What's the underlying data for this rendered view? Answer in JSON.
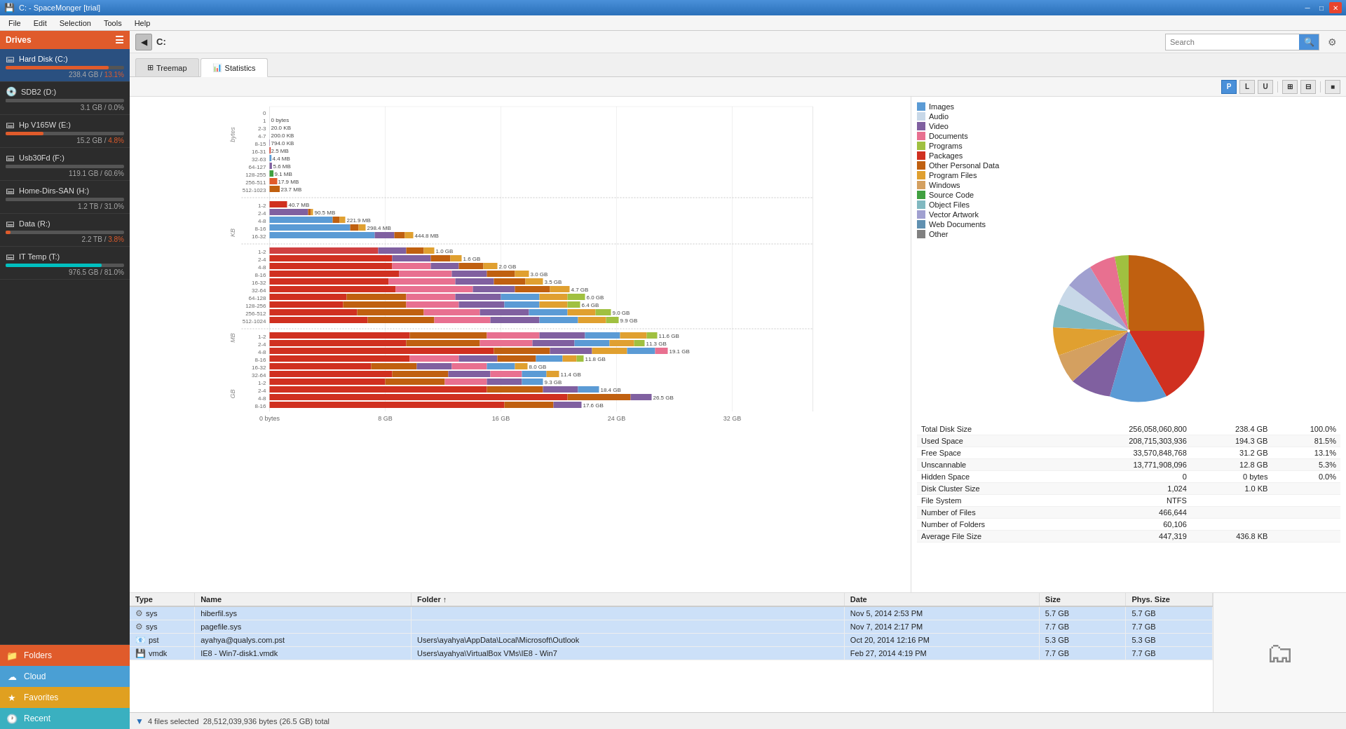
{
  "titlebar": {
    "title": "C: - SpaceMonger  [trial]",
    "controls": [
      "minimize",
      "maximize",
      "close"
    ]
  },
  "menubar": {
    "items": [
      "File",
      "Edit",
      "Selection",
      "Tools",
      "Help"
    ]
  },
  "toolbar": {
    "path": "C:",
    "search_placeholder": "Search",
    "gear_label": "⚙"
  },
  "tabs": [
    {
      "id": "treemap",
      "label": "Treemap",
      "active": false
    },
    {
      "id": "statistics",
      "label": "Statistics",
      "active": true
    }
  ],
  "view_buttons": [
    {
      "id": "btn-P",
      "label": "P",
      "active": true
    },
    {
      "id": "btn-L",
      "label": "L",
      "active": false
    },
    {
      "id": "btn-U",
      "label": "U",
      "active": false
    },
    {
      "id": "btn-grid1",
      "label": "⊞",
      "active": false
    },
    {
      "id": "btn-grid2",
      "label": "⊟",
      "active": false
    },
    {
      "id": "btn-grid3",
      "label": "☰",
      "active": false
    },
    {
      "id": "btn-dark",
      "label": "■",
      "active": false
    }
  ],
  "sidebar": {
    "drives_label": "Drives",
    "drives": [
      {
        "name": "Hard Disk (C:)",
        "icon": "hdd",
        "bar_pct": 87,
        "bar_color": "#e05b2b",
        "stats": "238.4 GB / 13.1%",
        "active": true
      },
      {
        "name": "SDB2 (D:)",
        "icon": "cd",
        "bar_pct": 2,
        "bar_color": "#555",
        "stats": "3.1 GB / 0.0%"
      },
      {
        "name": "Hp V165W (E:)",
        "icon": "usb",
        "bar_pct": 32,
        "bar_color": "#e05b2b",
        "stats": "15.2 GB / 4.8%"
      },
      {
        "name": "Usb30Fd (F:)",
        "icon": "usb",
        "bar_pct": 61,
        "bar_color": "#555",
        "stats": "119.1 GB / 60.6%"
      },
      {
        "name": "Home-Dirs-SAN (H:)",
        "icon": "net",
        "bar_pct": 31,
        "bar_color": "#555",
        "stats": "1.2 TB / 31.0%"
      },
      {
        "name": "Data (R:)",
        "icon": "net",
        "bar_pct": 4,
        "bar_color": "#e05b2b",
        "stats": "2.2 TB / 3.8%"
      },
      {
        "name": "IT Temp (T:)",
        "icon": "net",
        "bar_pct": 81,
        "bar_color": "#00c0c0",
        "stats": "976.5 GB / 81.0%"
      }
    ],
    "bottom_items": [
      {
        "id": "folders",
        "label": "Folders",
        "color": "#e05b2b",
        "icon": "📁"
      },
      {
        "id": "cloud",
        "label": "Cloud",
        "color": "#4a9fd4",
        "icon": "☁"
      },
      {
        "id": "favorites",
        "label": "Favorites",
        "color": "#e0a020",
        "icon": "★"
      },
      {
        "id": "recent",
        "label": "Recent",
        "color": "#3ab0c0",
        "icon": "🕐"
      }
    ]
  },
  "legend": {
    "items": [
      {
        "label": "Images",
        "color": "#5b9bd5"
      },
      {
        "label": "Audio",
        "color": "#c8d8e8"
      },
      {
        "label": "Video",
        "color": "#8060a0"
      },
      {
        "label": "Documents",
        "color": "#e87090"
      },
      {
        "label": "Programs",
        "color": "#a0c040"
      },
      {
        "label": "Packages",
        "color": "#d03020"
      },
      {
        "label": "Other Personal Data",
        "color": "#c06010"
      },
      {
        "label": "Program Files",
        "color": "#e0a030"
      },
      {
        "label": "Windows",
        "color": "#d4a060"
      },
      {
        "label": "Source Code",
        "color": "#40a040"
      },
      {
        "label": "Object Files",
        "color": "#80b8c0"
      },
      {
        "label": "Vector Artwork",
        "color": "#a0a0d0"
      },
      {
        "label": "Web Documents",
        "color": "#6090b0"
      },
      {
        "label": "Other",
        "color": "#808080"
      }
    ]
  },
  "disk_stats": {
    "rows": [
      {
        "label": "Total Disk Size",
        "bytes": "256,058,060,800",
        "gb": "238.4 GB",
        "pct": "100.0%"
      },
      {
        "label": "Used Space",
        "bytes": "208,715,303,936",
        "gb": "194.3 GB",
        "pct": "81.5%"
      },
      {
        "label": "Free Space",
        "bytes": "33,570,848,768",
        "gb": "31.2 GB",
        "pct": "13.1%"
      },
      {
        "label": "Unscannable",
        "bytes": "13,771,908,096",
        "gb": "12.8 GB",
        "pct": "5.3%"
      },
      {
        "label": "Hidden Space",
        "bytes": "0",
        "gb": "0 bytes",
        "pct": "0.0%"
      },
      {
        "label": "Disk Cluster Size",
        "bytes": "1,024",
        "gb": "1.0 KB",
        "pct": ""
      },
      {
        "label": "File System",
        "bytes": "NTFS",
        "gb": "",
        "pct": ""
      },
      {
        "label": "Number of Files",
        "bytes": "466,644",
        "gb": "",
        "pct": ""
      },
      {
        "label": "Number of Folders",
        "bytes": "60,106",
        "gb": "",
        "pct": ""
      },
      {
        "label": "Average File Size",
        "bytes": "447,319",
        "gb": "436.8 KB",
        "pct": ""
      }
    ]
  },
  "file_table": {
    "columns": [
      "Type",
      "Name",
      "Folder",
      "Date",
      "Size",
      "Phys. Size"
    ],
    "rows": [
      {
        "type": "sys",
        "icon": "⚙",
        "name": "hiberfil.sys",
        "folder": "",
        "date": "Nov 5, 2014  2:53 PM",
        "size": "5.7 GB",
        "phys_size": "5.7 GB",
        "selected": true
      },
      {
        "type": "sys",
        "icon": "⚙",
        "name": "pagefile.sys",
        "folder": "",
        "date": "Nov 7, 2014  2:17 PM",
        "size": "7.7 GB",
        "phys_size": "7.7 GB",
        "selected": true
      },
      {
        "type": "pst",
        "icon": "📧",
        "name": "ayahya@qualys.com.pst",
        "folder": "Users\\ayahya\\AppData\\Local\\Microsoft\\Outlook",
        "date": "Oct 20, 2014  12:16 PM",
        "size": "5.3 GB",
        "phys_size": "5.3 GB",
        "selected": true
      },
      {
        "type": "vmdk",
        "icon": "💾",
        "name": "IE8 - Win7-disk1.vmdk",
        "folder": "Users\\ayahya\\VirtualBox VMs\\IE8 - Win7",
        "date": "Feb 27, 2014  4:19 PM",
        "size": "7.7 GB",
        "phys_size": "7.7 GB",
        "selected": true
      }
    ]
  },
  "statusbar": {
    "selection": "4 files selected",
    "total": "28,512,039,936 bytes (26.5 GB) total"
  },
  "histogram": {
    "y_groups": [
      "bytes",
      "KB",
      "MB",
      "GB"
    ],
    "y_labels": [
      "0",
      "1",
      "2-3",
      "4-7",
      "8-15",
      "16-31",
      "32-63",
      "64-127",
      "128-255",
      "256-511",
      "512-1023",
      "1-2",
      "2-4",
      "4-8",
      "8-16",
      "16-32",
      "32-64",
      "64-128",
      "128-256",
      "256-512",
      "512-1024",
      "1-2",
      "2-4",
      "4-8",
      "8-16",
      "16-32",
      "32-64",
      "64-128",
      "128-256",
      "256-512",
      "512-1024",
      "1-2",
      "2-4",
      "4-8",
      "8-16"
    ],
    "x_labels": [
      "0 bytes",
      "8 GB",
      "16 GB",
      "24 GB",
      "32 GB"
    ],
    "values_text": [
      "0 bytes",
      "20.0 KB",
      "200.0 KB",
      "794.0 KB",
      "2.5 MB",
      "4.4 MB",
      "5.6 MB",
      "9.1 MB",
      "17.9 MB",
      "23.7 MB",
      "40.7 MB",
      "90.5 MB",
      "221.9 MB",
      "298.4 MB",
      "444.8 MB",
      "1.0 GB",
      "1.6 GB",
      "2.0 GB",
      "3.0 GB",
      "3.5 GB",
      "4.7 GB",
      "6.0 GB",
      "6.4 GB",
      "9.0 GB",
      "9.9 GB",
      "11.6 GB",
      "11.3 GB",
      "19.1 GB",
      "11.8 GB",
      "8.0 GB",
      "11.4 GB",
      "9.3 GB",
      "18.4 GB",
      "26.5 GB",
      "17.6 GB"
    ]
  }
}
